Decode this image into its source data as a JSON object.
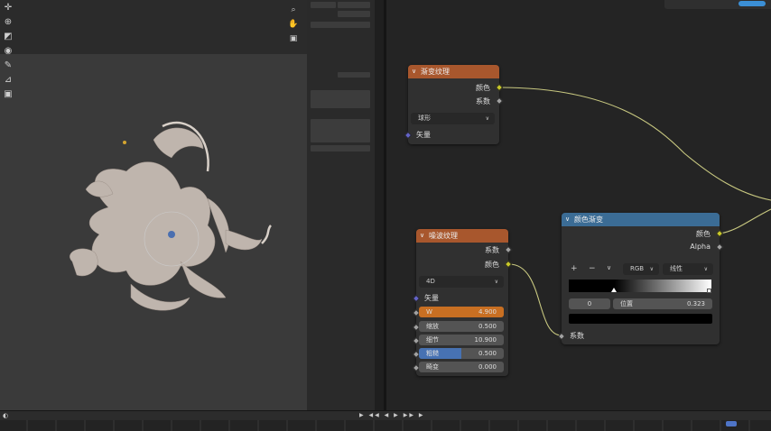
{
  "viewport": {
    "tools": [
      "cursor-icon",
      "move-icon",
      "scale-icon",
      "transform-icon",
      "annotate-icon",
      "measure-icon",
      "add-icon"
    ],
    "nav": [
      "zoom-icon",
      "hand-icon",
      "camera-icon"
    ]
  },
  "node_gradient": {
    "title": "渐变纹理",
    "outputs": [
      "颜色",
      "系数"
    ],
    "type_value": "球形",
    "input_vector": "矢量"
  },
  "node_noise": {
    "title": "噪波纹理",
    "outputs": [
      "系数",
      "颜色"
    ],
    "dimension": "4D",
    "input_vector": "矢量",
    "w_label": "W",
    "w_value": "4.900",
    "scale_label": "缩放",
    "scale_value": "0.500",
    "detail_label": "细节",
    "detail_value": "10.900",
    "roughness_label": "粗糙",
    "roughness_value": "0.500",
    "distortion_label": "畸变",
    "distortion_value": "0.000"
  },
  "node_ramp": {
    "title": "颜色渐变",
    "outputs": [
      "颜色",
      "Alpha"
    ],
    "add": "+",
    "remove": "−",
    "chev": "∨",
    "color_mode": "RGB",
    "interp": "线性",
    "stop_index": "0",
    "pos_label": "位置",
    "pos_value": "0.323",
    "input_fac": "系数"
  },
  "colors": {
    "orange_header": "#a8572d",
    "blue_header": "#3b6c95",
    "socket_yellow": "#c7c729",
    "socket_gray": "#a1a1a1",
    "socket_purple": "#6363c7",
    "wire": "#c8c880"
  }
}
